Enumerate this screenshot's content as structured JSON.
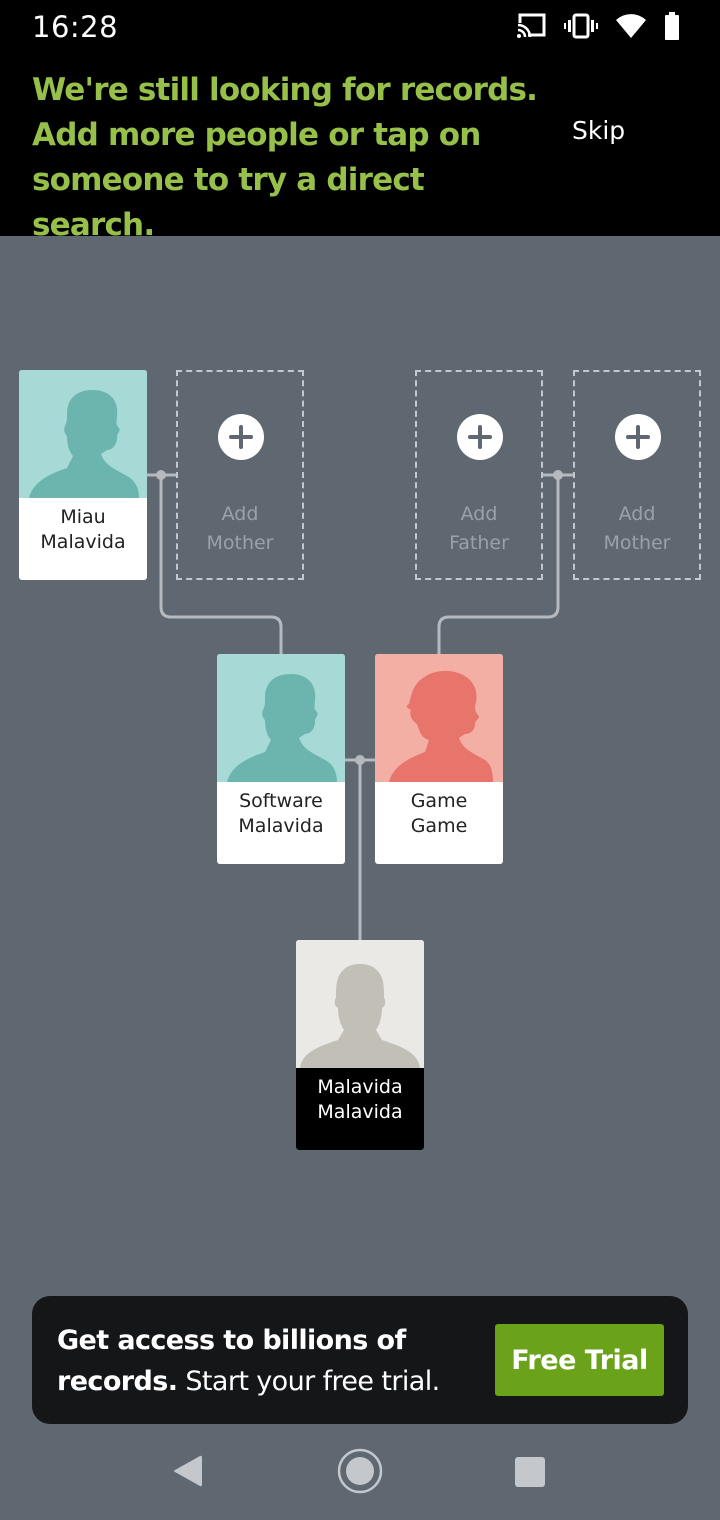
{
  "status_bar": {
    "time": "16:28",
    "icons": [
      "cast-icon",
      "vibrate-icon",
      "wifi-icon",
      "battery-icon"
    ]
  },
  "banner": {
    "message_lines": [
      "We're still looking for records.",
      "Add more people or tap on",
      "someone to try a direct search."
    ],
    "skip_label": "Skip",
    "accent_color": "#97c04a"
  },
  "tree": {
    "people": {
      "grandfather_paternal": {
        "first": "Miau",
        "last": "Malavida",
        "gender": "male"
      },
      "father": {
        "first": "Software",
        "last": "Malavida",
        "gender": "male"
      },
      "mother": {
        "first": "Game",
        "last": "Game",
        "gender": "female"
      },
      "self": {
        "first": "Malavida",
        "last": "Malavida",
        "gender": "unknown"
      }
    },
    "add_slots": {
      "paternal_grandmother": {
        "line1": "Add",
        "line2": "Mother"
      },
      "maternal_grandfather": {
        "line1": "Add",
        "line2": "Father"
      },
      "maternal_grandmother": {
        "line1": "Add",
        "line2": "Mother"
      }
    }
  },
  "promo": {
    "bold_text": "Get access to billions of records.",
    "bold_line1": "Get access to billions of",
    "bold_line2": "records.",
    "regular_text": "Start your free trial.",
    "button_label": "Free Trial",
    "button_color": "#6aa31a"
  },
  "nav_bar": {
    "buttons": [
      "back",
      "home",
      "recents"
    ]
  }
}
